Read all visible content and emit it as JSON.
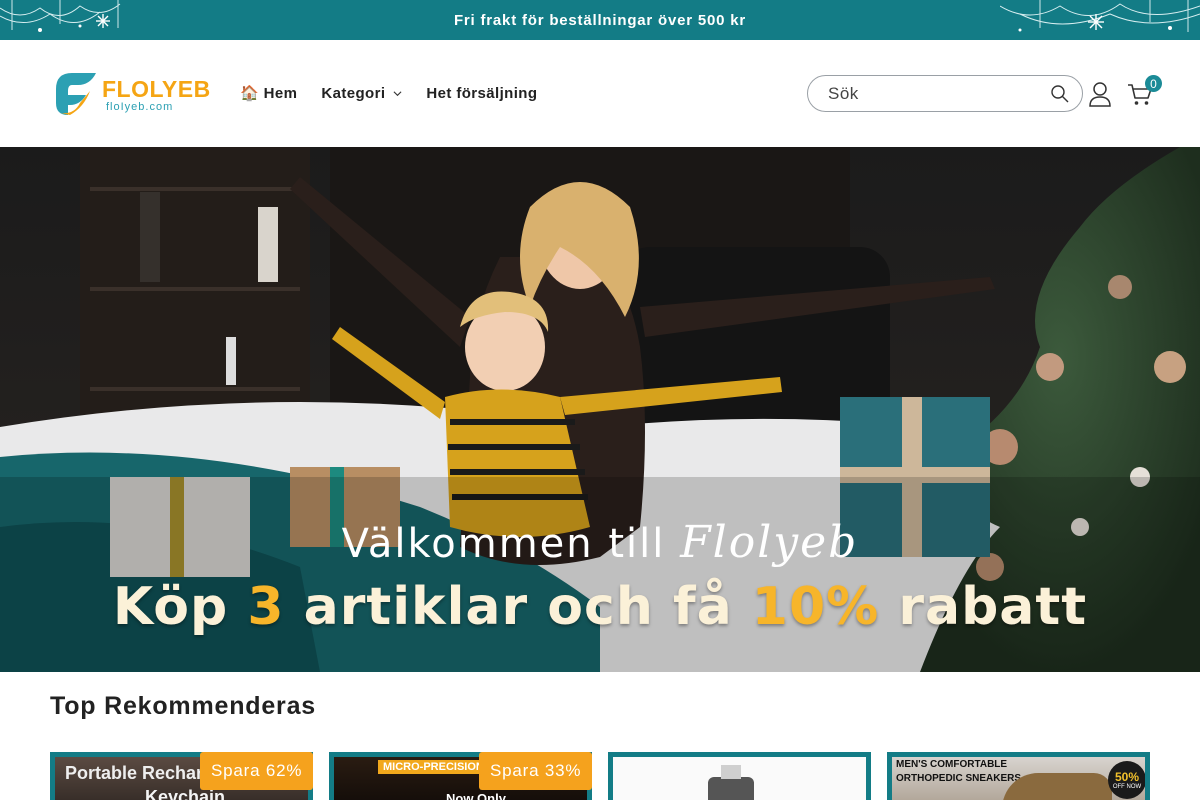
{
  "announcement": {
    "text": "Fri frakt för beställningar över 500 kr"
  },
  "header": {
    "logo": {
      "name": "FLOLYEB",
      "url": "floIyeb.com"
    },
    "nav": [
      {
        "label": "🏠 Hem"
      },
      {
        "label": "Kategori"
      },
      {
        "label": "Het försäljning"
      }
    ],
    "search": {
      "placeholder": "Sök"
    },
    "cart": {
      "count": "0"
    }
  },
  "hero": {
    "welcome_prefix": "Välkommen till",
    "welcome_brand": "Flolyeb",
    "offer_part1": "Köp",
    "offer_number": "3",
    "offer_part2": "artiklar och få",
    "offer_percent": "10%",
    "offer_part3": "rabatt"
  },
  "section": {
    "title": "Top Rekommenderas"
  },
  "products": [
    {
      "image_text_1": "Portable Recharg",
      "image_text_2": "Keychain Flashlight",
      "badge": "Spara 62%"
    },
    {
      "image_text_1": "MICRO-PRECISION",
      "image_text_2": "Now Only",
      "badge": "Spara 33%"
    },
    {
      "image_text_1": "",
      "image_text_2": "",
      "badge": ""
    },
    {
      "image_text_1": "MEN'S COMFORTABLE",
      "image_text_2": "ORTHOPEDIC SNEAKERS",
      "image_text_3": "50%",
      "image_text_4": "OFF NOW"
    }
  ],
  "colors": {
    "teal": "#137c86",
    "badge": "#f5a21d",
    "logo_orange": "#f5a514"
  }
}
